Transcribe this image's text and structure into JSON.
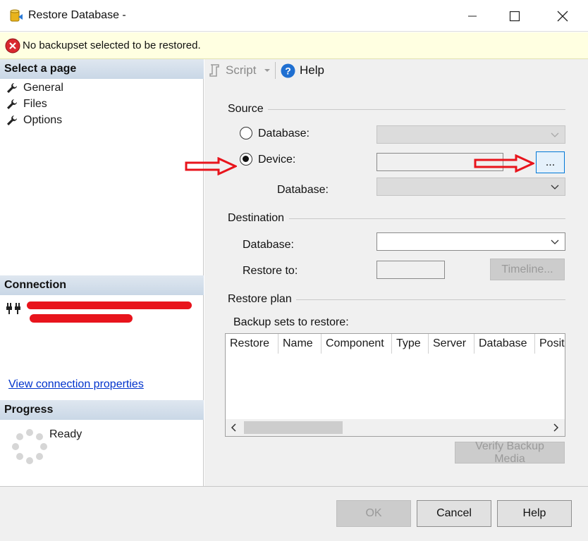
{
  "window": {
    "title": "Restore Database -",
    "controls": [
      "minimize",
      "maximize",
      "close"
    ]
  },
  "banner": {
    "message": "No backupset selected to be restored.",
    "icon": "error-icon",
    "color": "#ffffe1"
  },
  "left_pane": {
    "select_page_title": "Select a page",
    "pages": [
      {
        "label": "General",
        "icon": "wrench-icon"
      },
      {
        "label": "Files",
        "icon": "wrench-icon"
      },
      {
        "label": "Options",
        "icon": "wrench-icon"
      }
    ],
    "connection_title": "Connection",
    "connection_link": "View connection properties",
    "progress_title": "Progress",
    "progress_status": "Ready"
  },
  "toolbar": {
    "script_label": "Script",
    "help_label": "Help"
  },
  "source": {
    "title": "Source",
    "database_radio_label": "Database:",
    "device_radio_label": "Device:",
    "selected": "device",
    "browse_button": "...",
    "device_database_label": "Database:"
  },
  "destination": {
    "title": "Destination",
    "database_label": "Database:",
    "restore_to_label": "Restore to:",
    "timeline_button": "Timeline..."
  },
  "restore_plan": {
    "title": "Restore plan",
    "backup_sets_label": "Backup sets to restore:",
    "columns": [
      "Restore",
      "Name",
      "Component",
      "Type",
      "Server",
      "Database",
      "Posit"
    ],
    "verify_button": "Verify Backup Media"
  },
  "footer": {
    "ok_label": "OK",
    "cancel_label": "Cancel",
    "help_label": "Help"
  },
  "colors": {
    "accent_error": "#d9282f",
    "annotation_arrow": "#e8141c",
    "link": "#0033cc"
  }
}
